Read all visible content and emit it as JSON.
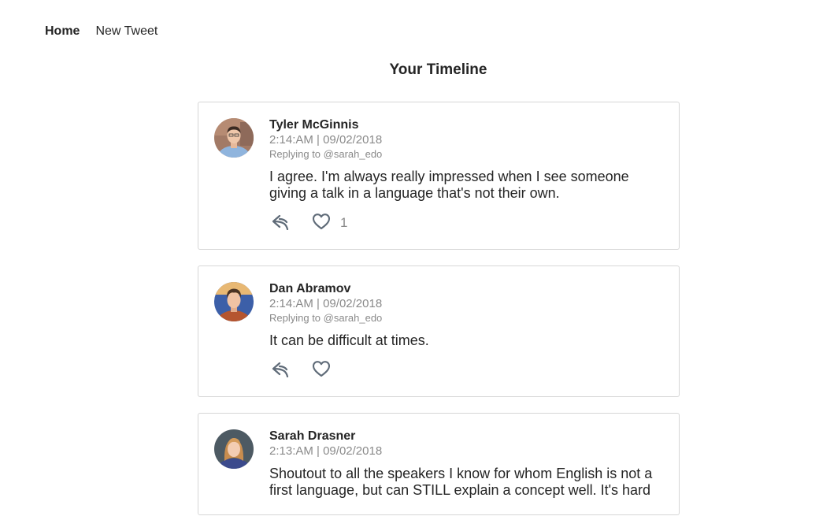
{
  "nav": {
    "home_label": "Home",
    "new_tweet_label": "New Tweet"
  },
  "page": {
    "title": "Your Timeline"
  },
  "colors": {
    "text": "#252525",
    "muted": "#8a8a8a",
    "border": "#d6d6d6",
    "icon": "#5f6b78"
  },
  "tweets": [
    {
      "author": "Tyler McGinnis",
      "timestamp": "2:14:AM | 09/02/2018",
      "replying_to": "Replying to @sarah_edo",
      "text": "I agree. I'm always really impressed when I see someone giving a talk in a language that's not their own.",
      "likes": "1",
      "avatar_icon": "avatar-tyler"
    },
    {
      "author": "Dan Abramov",
      "timestamp": "2:14:AM | 09/02/2018",
      "replying_to": "Replying to @sarah_edo",
      "text": "It can be difficult at times.",
      "likes": "",
      "avatar_icon": "avatar-dan"
    },
    {
      "author": "Sarah Drasner",
      "timestamp": "2:13:AM | 09/02/2018",
      "replying_to": "",
      "text": "Shoutout to all the speakers I know for whom English is not a first language, but can STILL explain a concept well. It's hard",
      "likes": "",
      "avatar_icon": "avatar-sarah"
    }
  ]
}
